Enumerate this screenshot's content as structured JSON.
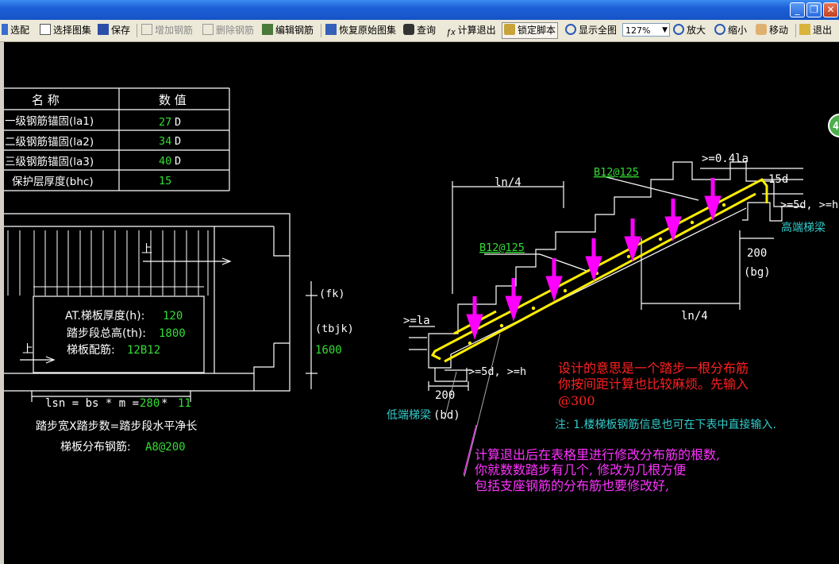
{
  "toolbar": {
    "items": [
      {
        "label": "选配",
        "icon": "select-icon",
        "enabled": true
      },
      {
        "label": "选择图集",
        "icon": "atlas-icon",
        "enabled": true
      },
      {
        "label": "保存",
        "icon": "save-icon",
        "enabled": true
      },
      {
        "label": "增加钢筋",
        "icon": "add-rebar-icon",
        "enabled": false
      },
      {
        "label": "删除钢筋",
        "icon": "delete-rebar-icon",
        "enabled": false
      },
      {
        "label": "编辑钢筋",
        "icon": "edit-rebar-icon",
        "enabled": true
      },
      {
        "label": "恢复原始图集",
        "icon": "restore-icon",
        "enabled": true
      },
      {
        "label": "查询",
        "icon": "binoculars-icon",
        "enabled": true
      },
      {
        "label": "计算退出",
        "icon": "fx-icon",
        "enabled": true
      },
      {
        "label": "锁定脚本",
        "icon": "lock-icon",
        "enabled": true
      },
      {
        "label": "显示全图",
        "icon": "zoom-fit-icon",
        "enabled": true
      },
      {
        "label": "放大",
        "icon": "zoom-in-icon",
        "enabled": true
      },
      {
        "label": "缩小",
        "icon": "zoom-out-icon",
        "enabled": true
      },
      {
        "label": "移动",
        "icon": "pan-hand-icon",
        "enabled": true
      },
      {
        "label": "退出",
        "icon": "exit-icon",
        "enabled": true
      }
    ],
    "zoom_value": "127%"
  },
  "window_buttons": {
    "minimize": "_",
    "maximize": "❐",
    "close": "✕"
  },
  "colors": {
    "background": "#000000",
    "line": "#ffffff",
    "value": "#33dd33",
    "magenta": "#ff00ff",
    "yellow": "#ffee00",
    "red": "#ff2020",
    "cyan": "#33cccc",
    "green_label": "#33dd33"
  },
  "param_table": {
    "header_name": "名 称",
    "header_value": "数 值",
    "rows": [
      {
        "name": "一级钢筋锚固(la1)",
        "value": "27",
        "unit": "D"
      },
      {
        "name": "二级钢筋锚固(la2)",
        "value": "34",
        "unit": "D"
      },
      {
        "name": "三级钢筋锚固(la3)",
        "value": "40",
        "unit": "D"
      },
      {
        "name": "保护层厚度(bhc)",
        "value": "15",
        "unit": ""
      }
    ]
  },
  "plan": {
    "up1": "上",
    "up2": "上",
    "thickness_label": "AT.梯板厚度(h):",
    "thickness_value": "120",
    "height_label": "踏步段总高(th):",
    "height_value": "1800",
    "rebar_label": "梯板配筋:",
    "rebar_value": "12B12",
    "fk": "(fk)",
    "tbjk": "(tbjk)",
    "tbjk_value": "1600",
    "lsn_formula_a": "lsn = bs * m = ",
    "lsn_bs": "280",
    "lsn_star": " * ",
    "lsn_m": "11",
    "formula_text": "踏步宽X踏步数=踏步段水平净长",
    "dist_label": "梯板分布钢筋:",
    "dist_value": "A8@200"
  },
  "section": {
    "ln4_top": "ln/4",
    "ln4_bottom": "ln/4",
    "b12_top": "B12@125",
    "b12_mid": "B12@125",
    "ge041la": ">=0.4la",
    "d15": "15d",
    "ge5d_h_top": ">=5d, >=h",
    "high_beam": "高端梯梁",
    "dim200_right": "200",
    "bg": "(bg)",
    "ge_la": ">=la",
    "ge5d_h_bottom": ">=5d, >=h",
    "dim200_left": "200",
    "low_beam": "低端梯梁",
    "bd": "(bd)"
  },
  "notes": {
    "red_line1": "设计的意思是一个踏步一根分布筋",
    "red_line2": "你按间距计算也比较麻烦。先输入",
    "red_line3": "@300",
    "cyan_note": "注: 1.楼梯板钢筋信息也可在下表中直接输入.",
    "mag_line1": "计算退出后在表格里进行修改分布筋的根数,",
    "mag_line2": "你就数数踏步有几个, 修改为几根方便",
    "mag_line3": "包括支座钢筋的分布筋也要修改好,"
  },
  "edge_badge": "4"
}
